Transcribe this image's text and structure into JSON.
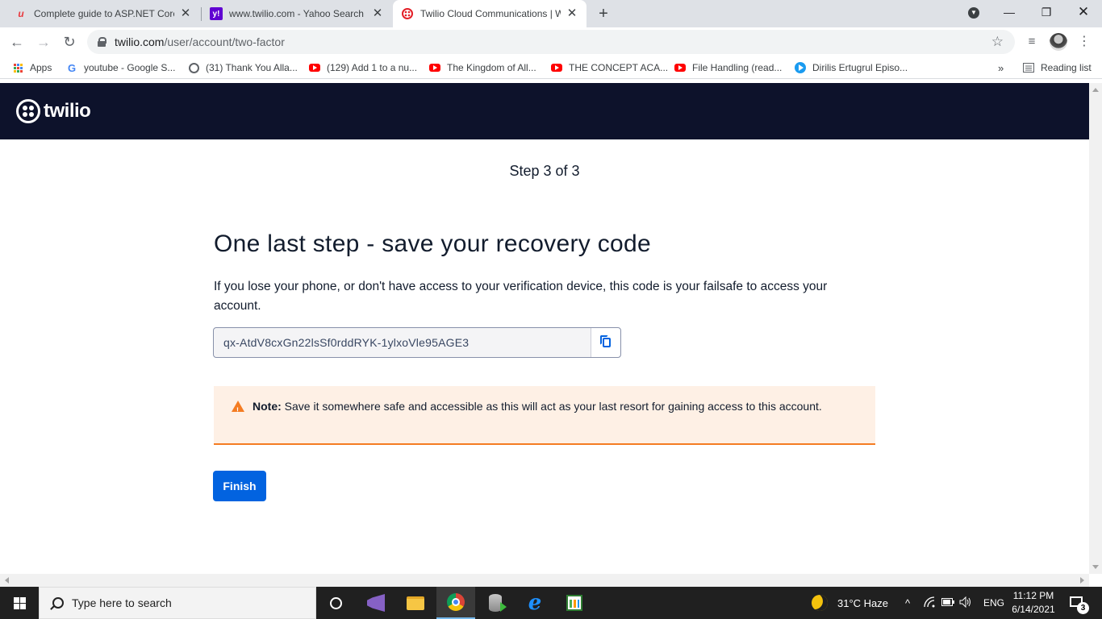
{
  "browser": {
    "tabs": [
      {
        "title": "Complete guide to ASP.NET Core",
        "favicon": "udemy-icon"
      },
      {
        "title": "www.twilio.com - Yahoo Search R",
        "favicon": "yahoo-icon"
      },
      {
        "title": "Twilio Cloud Communications | W",
        "favicon": "twilio-icon"
      }
    ],
    "url_host": "twilio.com",
    "url_path": "/user/account/two-factor",
    "bookmarks": [
      {
        "label": "Apps",
        "icon": "apps-grid-icon"
      },
      {
        "label": "youtube - Google S...",
        "icon": "google-icon"
      },
      {
        "label": "(31) Thank You Alla...",
        "icon": "globe-icon"
      },
      {
        "label": "(129) Add 1 to a nu...",
        "icon": "youtube-icon"
      },
      {
        "label": "The Kingdom of All...",
        "icon": "youtube-icon"
      },
      {
        "label": "THE CONCEPT ACA...",
        "icon": "youtube-icon"
      },
      {
        "label": "File Handling (read...",
        "icon": "youtube-icon"
      },
      {
        "label": "Dirilis Ertugrul Episo...",
        "icon": "play-icon"
      }
    ],
    "bookmarks_overflow": "»",
    "reading_list": "Reading list"
  },
  "page": {
    "logo_text": "twilio",
    "step": "Step 3 of 3",
    "heading": "One last step - save your recovery code",
    "description": "If you lose your phone, or don't have access to your verification device, this code is your failsafe to access your account.",
    "recovery_code": "qx-AtdV8cxGn22lsSf0rddRYK-1ylxoVle95AGE3",
    "note_label": "Note:",
    "note_text": "Save it somewhere safe and accessible as this will act as your last resort for gaining access to this account.",
    "finish_label": "Finish",
    "colors": {
      "header_bg": "#0d122b",
      "primary": "#0263e0",
      "note_bg": "#fef0e5",
      "note_border": "#f47c22"
    }
  },
  "taskbar": {
    "search_placeholder": "Type here to search",
    "weather": "31°C  Haze",
    "language": "ENG",
    "time": "11:12 PM",
    "date": "6/14/2021",
    "notifications": "3"
  }
}
